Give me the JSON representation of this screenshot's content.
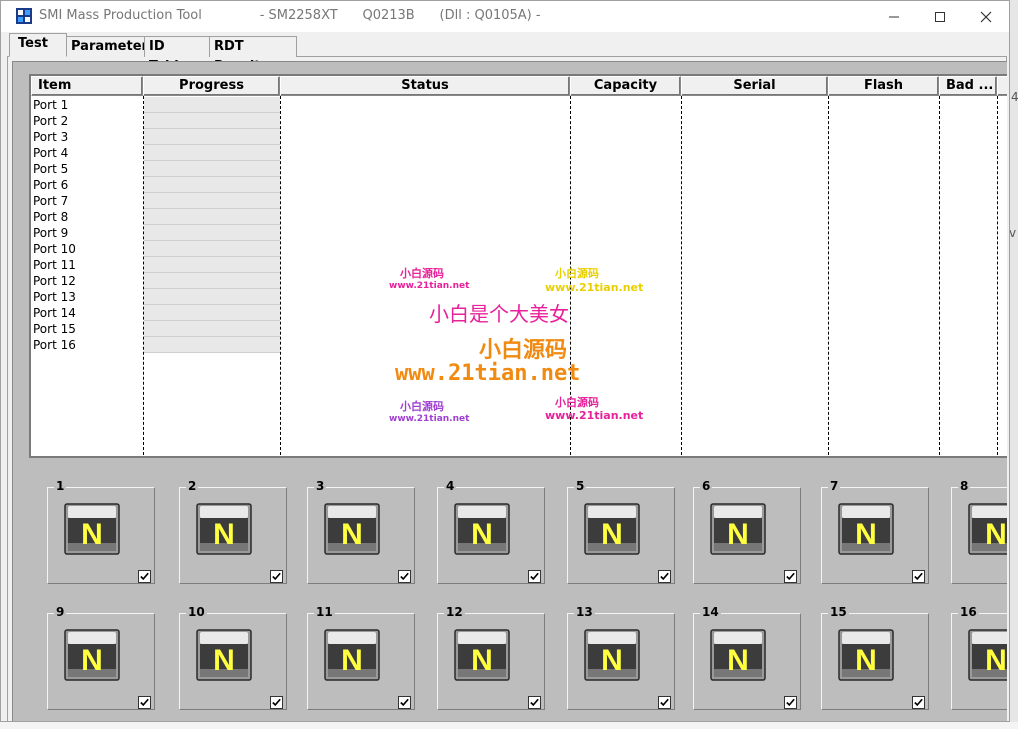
{
  "window": {
    "title": "SMI Mass Production Tool              - SM2258XT      Q0213B      (Dll : Q0105A) -"
  },
  "tabs": [
    {
      "label": "Test",
      "active": true
    },
    {
      "label": "Parameter",
      "active": false
    },
    {
      "label": "ID Table",
      "active": false
    },
    {
      "label": "RDT Result",
      "active": false
    }
  ],
  "list": {
    "columns": [
      "Item",
      "Progress",
      "Status",
      "Capacity",
      "Serial",
      "Flash",
      "Bad ..."
    ],
    "rows": [
      "Port 1",
      "Port 2",
      "Port 3",
      "Port 4",
      "Port 5",
      "Port 6",
      "Port 7",
      "Port 8",
      "Port 9",
      "Port 10",
      "Port 11",
      "Port 12",
      "Port 13",
      "Port 14",
      "Port 15",
      "Port 16"
    ]
  },
  "watermarks": {
    "small_cn": "小白源码",
    "small_url": "www.21tian.net",
    "big_cn": "小白是个大美女",
    "mid_cn": "小白源码",
    "big_url": "www.21tian.net"
  },
  "ports": {
    "icon_letter": "N",
    "row1": [
      "1",
      "2",
      "3",
      "4",
      "5",
      "6",
      "7",
      "8"
    ],
    "row2": [
      "9",
      "10",
      "11",
      "12",
      "13",
      "14",
      "15",
      "16"
    ]
  },
  "colors": {
    "accent_magenta": "#e8209a",
    "accent_orange": "#f08a10",
    "accent_yellow": "#e8d000",
    "port_letter": "#ffff40"
  }
}
